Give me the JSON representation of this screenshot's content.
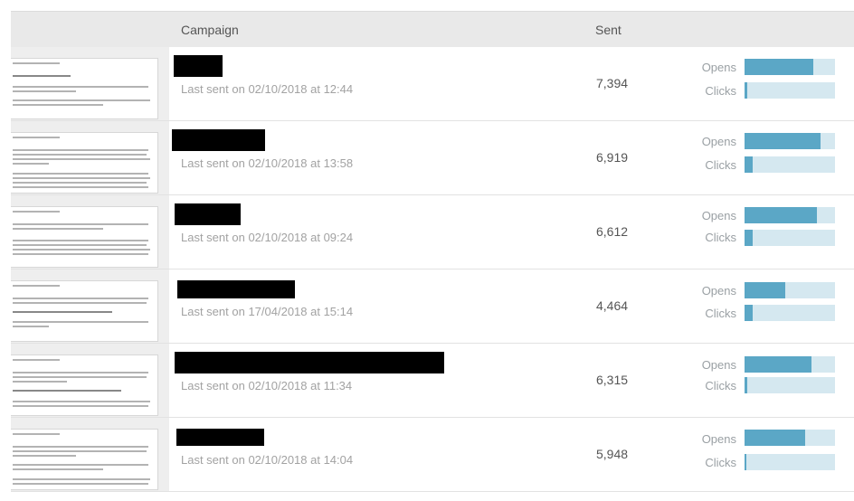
{
  "header": {
    "campaign_label": "Campaign",
    "sent_label": "Sent"
  },
  "metric_labels": {
    "opens": "Opens",
    "clicks": "Clicks"
  },
  "colors": {
    "bar_fill": "#5ba7c6",
    "bar_track": "#d5e8f0",
    "header_bg": "#e9e9e9"
  },
  "campaigns": [
    {
      "name_redacted": true,
      "last_sent": "Last sent on 02/10/2018 at 12:44",
      "sent": "7,394",
      "opens_pct": 0.76,
      "clicks_pct": 0.03
    },
    {
      "name_redacted": true,
      "last_sent": "Last sent on 02/10/2018 at 13:58",
      "sent": "6,919",
      "opens_pct": 0.84,
      "clicks_pct": 0.09
    },
    {
      "name_redacted": true,
      "last_sent": "Last sent on 02/10/2018 at 09:24",
      "sent": "6,612",
      "opens_pct": 0.8,
      "clicks_pct": 0.09
    },
    {
      "name_redacted": true,
      "last_sent": "Last sent on 17/04/2018 at 15:14",
      "sent": "4,464",
      "opens_pct": 0.45,
      "clicks_pct": 0.09
    },
    {
      "name_redacted": true,
      "last_sent": "Last sent on 02/10/2018 at 11:34",
      "sent": "6,315",
      "opens_pct": 0.74,
      "clicks_pct": 0.03
    },
    {
      "name_redacted": true,
      "last_sent": "Last sent on 02/10/2018 at 14:04",
      "sent": "5,948",
      "opens_pct": 0.67,
      "clicks_pct": 0.02
    }
  ]
}
